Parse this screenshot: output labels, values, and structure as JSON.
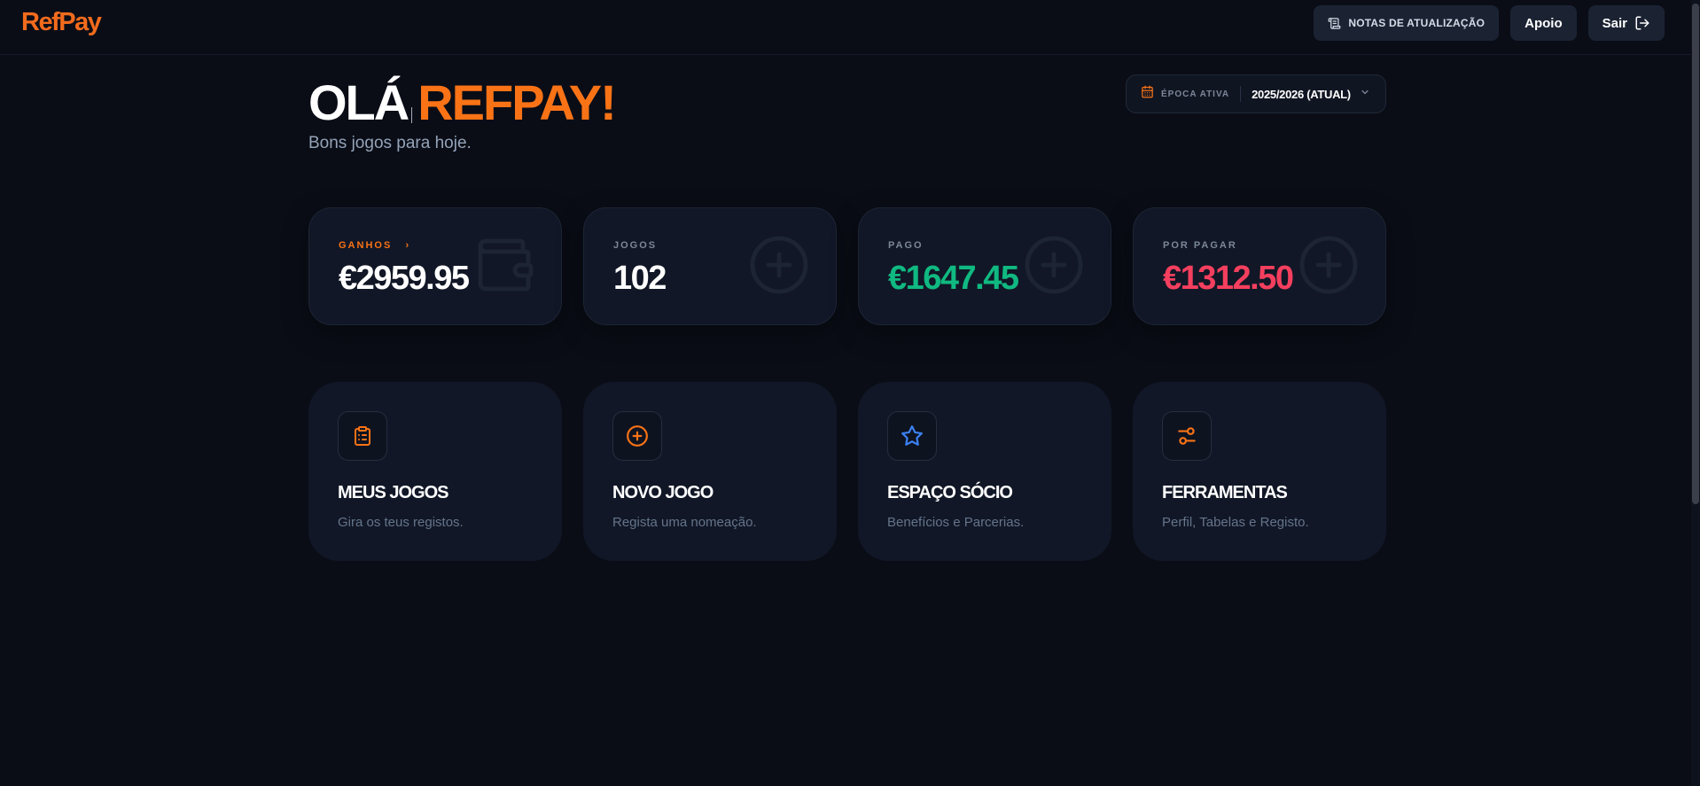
{
  "app": {
    "logo": "RefPay"
  },
  "header": {
    "notes_label": "NOTAS DE ATUALIZAÇÃO",
    "support_label": "Apoio",
    "logout_label": "Sair"
  },
  "greeting": {
    "hello": "OLÁ",
    "name": "REFPAY!",
    "subtitle": "Bons jogos para hoje."
  },
  "season": {
    "label": "ÉPOCA ATIVA",
    "value": "2025/2026 (ATUAL)"
  },
  "stats": [
    {
      "label": "GANHOS",
      "arrow": "›",
      "value": "€2959.95",
      "icon": "wallet-icon"
    },
    {
      "label": "JOGOS",
      "value": "102",
      "icon": "plus-circle-icon"
    },
    {
      "label": "PAGO",
      "value": "€1647.45",
      "icon": "plus-circle-icon"
    },
    {
      "label": "POR PAGAR",
      "value": "€1312.50",
      "icon": "plus-circle-icon"
    }
  ],
  "actions": [
    {
      "title": "MEUS JOGOS",
      "desc": "Gira os teus registos.",
      "icon": "clipboard-icon"
    },
    {
      "title": "NOVO JOGO",
      "desc": "Regista uma nomeação.",
      "icon": "plus-circle-icon"
    },
    {
      "title": "ESPAÇO SÓCIO",
      "desc": "Benefícios e Parcerias.",
      "icon": "star-icon"
    },
    {
      "title": "FERRAMENTAS",
      "desc": "Perfil, Tabelas e Registo.",
      "icon": "sliders-icon"
    }
  ],
  "colors": {
    "accent": "#f97316",
    "paid": "#10b981",
    "due": "#f43f5e",
    "star": "#3b82f6",
    "background": "#0a0d16"
  }
}
